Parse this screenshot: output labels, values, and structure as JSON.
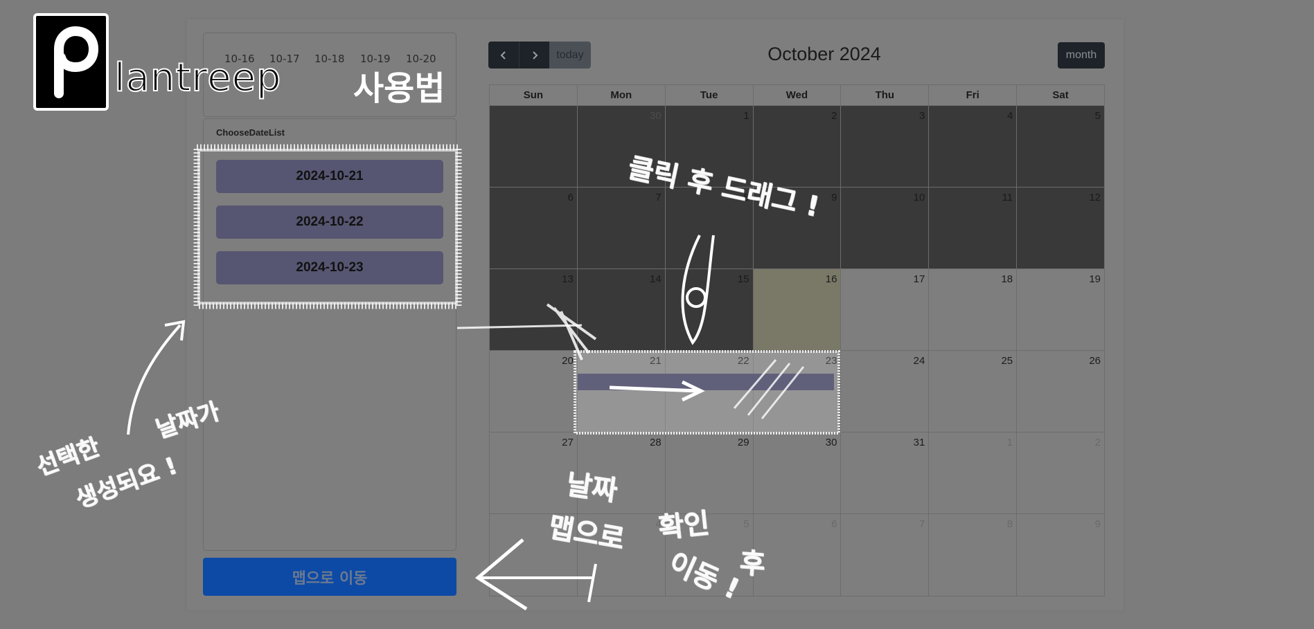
{
  "logo": {
    "wordmark": "lantreep",
    "subtitle": "사용법"
  },
  "date_strip": [
    "10-16",
    "10-17",
    "10-18",
    "10-19",
    "10-20"
  ],
  "choose_list": {
    "title": "ChooseDateList",
    "dates": [
      "2024-10-21",
      "2024-10-22",
      "2024-10-23"
    ]
  },
  "move_button": "맵으로 이동",
  "calendar": {
    "title": "October 2024",
    "today_label": "today",
    "view_label": "month",
    "weekdays": [
      "Sun",
      "Mon",
      "Tue",
      "Wed",
      "Thu",
      "Fri",
      "Sat"
    ],
    "weeks": [
      [
        "",
        "30",
        "1",
        "2",
        "3",
        "4",
        "5"
      ],
      [
        "6",
        "7",
        "8",
        "9",
        "10",
        "11",
        "12"
      ],
      [
        "13",
        "14",
        "15",
        "16",
        "17",
        "18",
        "19"
      ],
      [
        "20",
        "21",
        "22",
        "23",
        "24",
        "25",
        "26"
      ],
      [
        "27",
        "28",
        "29",
        "30",
        "31",
        "1",
        "2"
      ],
      [
        "3",
        "4",
        "5",
        "6",
        "7",
        "8",
        "9"
      ]
    ]
  },
  "annotations": {
    "click_drag": "클릭 후 드래그 !",
    "created_1": "선택한",
    "created_2": "날짜가",
    "created_3": "생성되요 !",
    "check_1": "날짜",
    "check_2": "맵으로",
    "check_3": "확인",
    "check_4": "후",
    "check_5": "이동 !"
  },
  "colors": {
    "background": "#7c7c7c",
    "dark_cell": "#393939",
    "today_cell": "#7a7866",
    "date_button": "#565672",
    "move_button": "#0d4aa6",
    "chalk": "#ffffff"
  },
  "icons": [
    "chevron-left-icon",
    "chevron-right-icon",
    "logo-p-icon"
  ]
}
